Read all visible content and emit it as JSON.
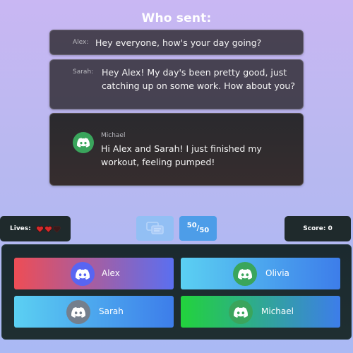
{
  "title": "Who sent:",
  "messages": [
    {
      "sender": "Alex:",
      "text": "Hey everyone, how's your day going?"
    },
    {
      "sender": "Sarah:",
      "text": "Hey Alex! My day's been pretty good, just catching up on some work. How about you?"
    },
    {
      "sender": "Michael",
      "text": "Hi Alex and Sarah! I just finished my workout, feeling pumped!",
      "avatar_icon": "discord-icon",
      "avatar_color": "#3aa55c"
    }
  ],
  "lives": {
    "label": "Lives:",
    "total": 3,
    "remaining": 2,
    "heart_color": "#d62a2a"
  },
  "lifelines": {
    "hint_icon": "chat-bubbles-icon",
    "fifty_top": "50",
    "fifty_slash": "/",
    "fifty_bottom": "50"
  },
  "score": {
    "label": "Score:",
    "value": "0"
  },
  "choices": [
    {
      "name": "Alex",
      "avatar_color": "#5865f2"
    },
    {
      "name": "Olivia",
      "avatar_color": "#3aa55c"
    },
    {
      "name": "Sarah",
      "avatar_color": "#747f8d"
    },
    {
      "name": "Michael",
      "avatar_color": "#3aa55c"
    }
  ]
}
